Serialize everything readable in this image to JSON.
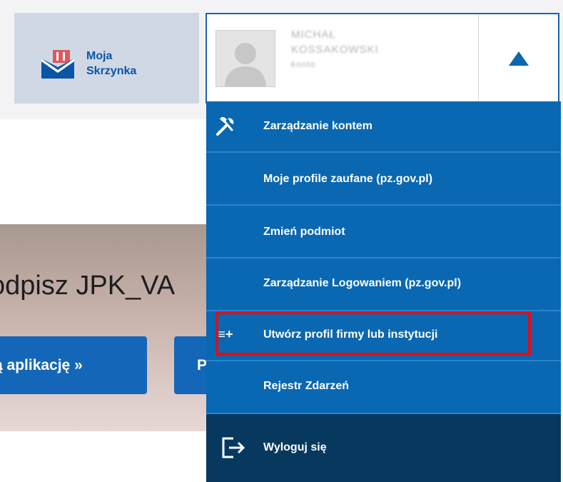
{
  "inbox": {
    "line1": "Moja",
    "line2": "Skrzynka"
  },
  "user": {
    "name_line1": "MICHAŁ",
    "name_line2": "KOSSAKOWSKI",
    "sub": "konto"
  },
  "hero": {
    "title": "odpisz JPK_VA",
    "button1": "ą aplikację »",
    "button2": "P"
  },
  "menu": {
    "items": [
      {
        "label": "Zarządzanie kontem",
        "icon": "tools-icon"
      },
      {
        "label": "Moje profile zaufane (pz.gov.pl)"
      },
      {
        "label": "Zmień podmiot"
      },
      {
        "label": "Zarządzanie Logowaniem (pz.gov.pl)"
      },
      {
        "label": "Utwórz profil firmy lub instytucji",
        "icon": "list-add-icon",
        "icon_glyph": "≡+"
      },
      {
        "label": "Rejestr Zdarzeń"
      }
    ],
    "logout": {
      "label": "Wyloguj się",
      "icon": "logout-icon"
    }
  },
  "colors": {
    "menu_bg": "#0a67b1",
    "logout_bg": "#07395f",
    "highlight": "#e10e16",
    "accent": "#1b62b2"
  }
}
